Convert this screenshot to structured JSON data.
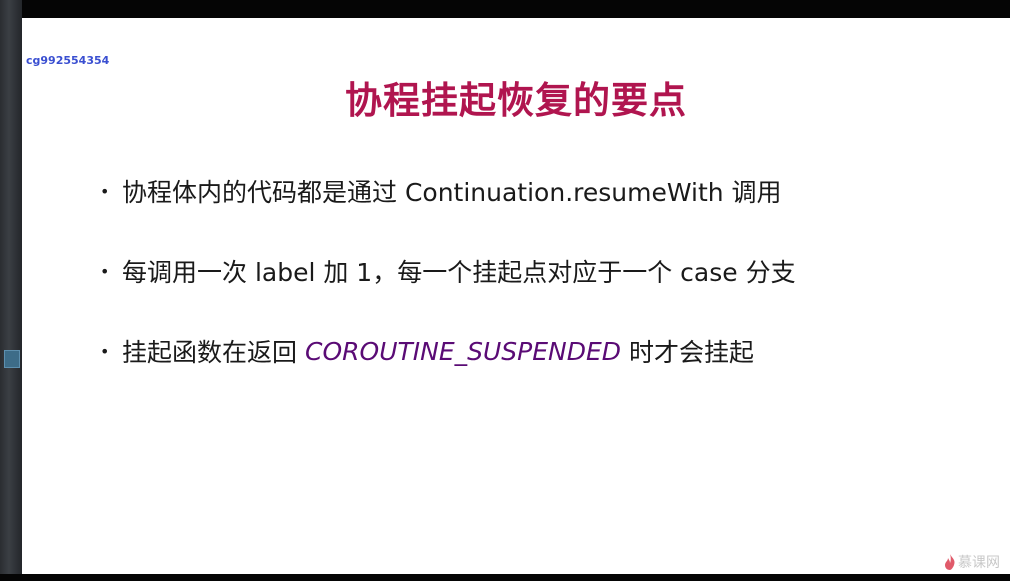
{
  "watermark": {
    "user": "cg992554354",
    "brand": "慕课网"
  },
  "slide": {
    "title": "协程挂起恢复的要点",
    "bullets": [
      {
        "text_before": "协程体内的代码都是通过 Continuation.resumeWith 调用"
      },
      {
        "text_before": "每调用一次 label 加 1，每一个挂起点对应于一个 case 分支"
      },
      {
        "text_before": "挂起函数在返回",
        "code": "COROUTINE_SUSPENDED",
        "text_after": "时才会挂起"
      }
    ]
  },
  "colors": {
    "title": "#b0154f",
    "code": "#5a0b75",
    "watermark_user": "#3a4fd1"
  }
}
